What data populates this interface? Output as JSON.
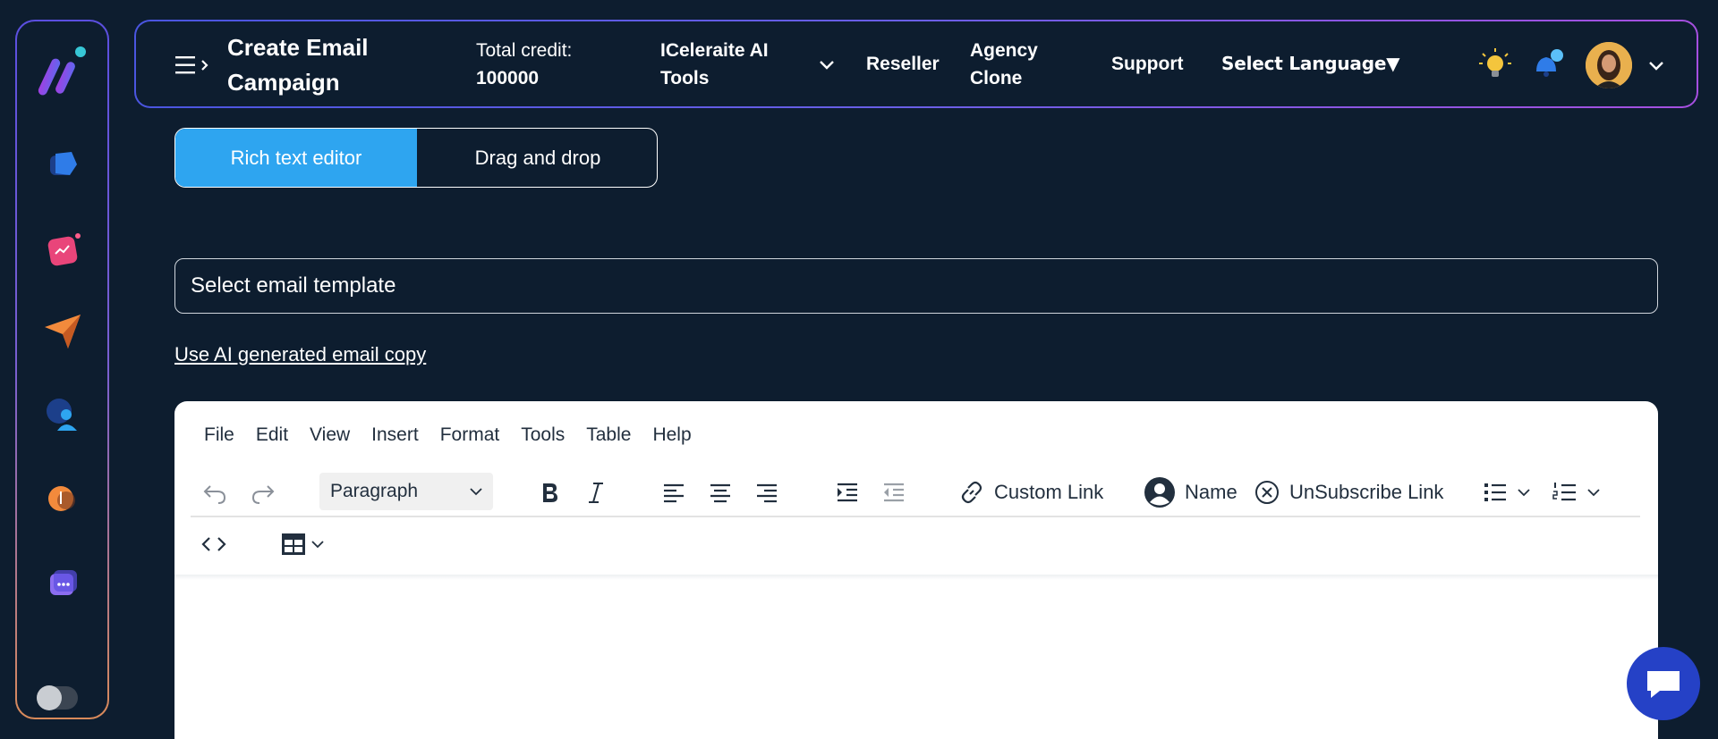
{
  "header": {
    "title": "Create Email Campaign",
    "credit_label": "Total credit:",
    "credit_value": "100000",
    "nav": {
      "tools": "ICeleraite AI Tools",
      "reseller": "Reseller",
      "agency": "Agency Clone",
      "support": "Support",
      "language": "Select Language▼"
    }
  },
  "sidebar": {
    "items": [
      {
        "icon": "logo-icon"
      },
      {
        "icon": "dashboard-icon"
      },
      {
        "icon": "analytics-icon"
      },
      {
        "icon": "send-icon"
      },
      {
        "icon": "contacts-icon"
      },
      {
        "icon": "audio-icon"
      },
      {
        "icon": "chat-icon"
      }
    ]
  },
  "tabs": {
    "rich": "Rich text editor",
    "dnd": "Drag and drop",
    "active": "rich"
  },
  "template_select": {
    "value": "Select email template"
  },
  "ai_link": "Use AI generated email copy",
  "editor": {
    "menu": [
      "File",
      "Edit",
      "View",
      "Insert",
      "Format",
      "Tools",
      "Table",
      "Help"
    ],
    "paragraph": "Paragraph",
    "custom_link": "Custom Link",
    "name": "Name",
    "unsubscribe": "UnSubscribe Link"
  },
  "colors": {
    "background": "#0d1d2f",
    "accent": "#2ea5f0",
    "chat": "#2541c6"
  }
}
